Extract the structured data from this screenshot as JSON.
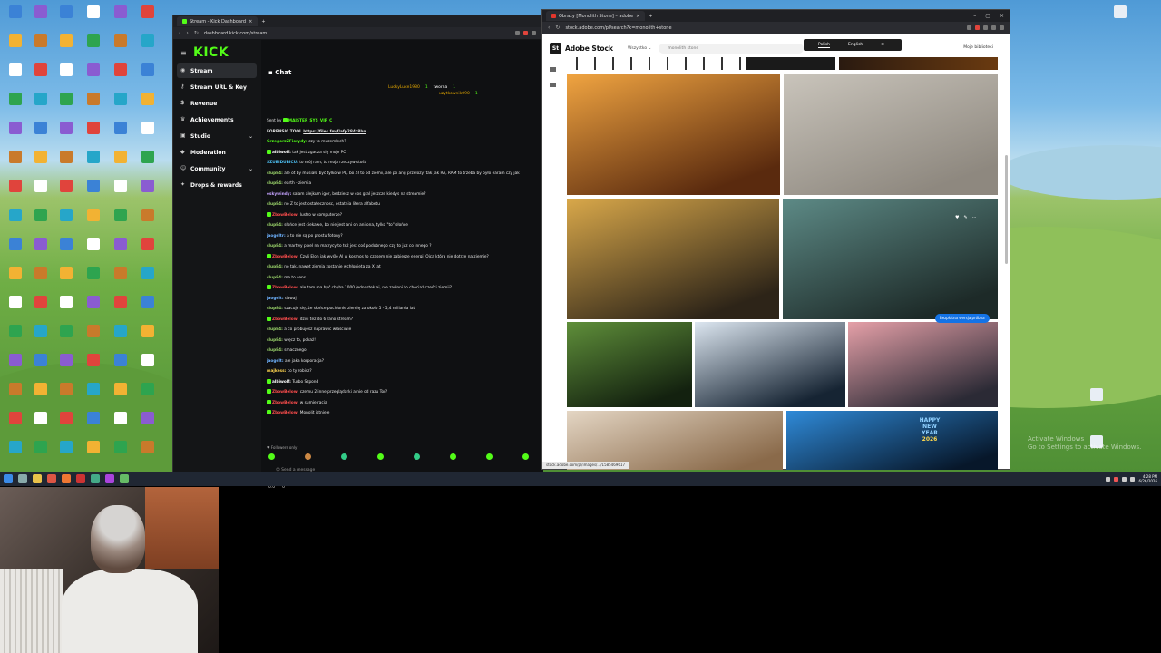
{
  "kick_window": {
    "tab_title": "Stream - Kick Dashboard",
    "url": "dashboard.kick.com/stream",
    "logo": "KICK",
    "nav": [
      "Stream",
      "Stream URL & Key",
      "Revenue",
      "Achievements",
      "Studio",
      "Moderation",
      "Community",
      "Drops & rewards"
    ],
    "chat_title": "Chat",
    "leaderboard": [
      {
        "name": "LuckyLuke1980",
        "count": "1"
      },
      {
        "name": "tworna",
        "count": "1"
      },
      {
        "name": "uzytkownik090",
        "count": "1"
      }
    ],
    "pinned": {
      "sent_by": "Sent by",
      "sender": "MAJSTER_SYS_VIP_C",
      "tool_label": "FORENSIC TOOL",
      "tool_url": "https://files.fm/f/afp284c8hn"
    },
    "messages": [
      {
        "user": "GrzegorzZFiorydy:",
        "text": "czy to muzemlech?"
      },
      {
        "user": "albiwolf:",
        "text": "tak jest zgadza się moje PC"
      },
      {
        "user": "SZUBIDUBICU:",
        "text": "to mój ram, to moja rzeczywistość"
      },
      {
        "user": "slup84:",
        "text": "ale ot by musiało być tylko w PL, bo Zł to od ziemii, ale po ang przelożył tak jak RA, RAM to trzeba by było earam czy jak"
      },
      {
        "user": "slup84:",
        "text": "earth - ziemia"
      },
      {
        "user": "eskywindy:",
        "text": "salam alejkum igor, bedziesz w cos gral jeszcze kiedys na streamie?"
      },
      {
        "user": "slup84:",
        "text": "no Z to jest ostatecznosc, ostatnia litera alfabetu"
      },
      {
        "user": "ZbowBelow:",
        "text": "lustro w komputerze?"
      },
      {
        "user": "slup84:",
        "text": "słońce jest ciekawe, bo nie jest ani on ani ona, tylko \"to\" słońce"
      },
      {
        "user": "jaogeltr:",
        "text": "a to nie są po prostu fotony?"
      },
      {
        "user": "slup84:",
        "text": "a martwy pixel na matrycy to też jest coś podobnego czy to juz co innego ?"
      },
      {
        "user": "ZbowBelow:",
        "text": "Czyli Elon jak wyśle AI w kosmos to czasem nie zabierze energii Ojca która nie dotrze na ziemie?"
      },
      {
        "user": "slup84:",
        "text": "no tak, nawet ziemia zostanie wchłonięta za X lat"
      },
      {
        "user": "slup84:",
        "text": "ma to sens"
      },
      {
        "user": "ZbowBelow:",
        "text": "ale tam ma być chyba 1000 jednostek ai, nie zasłoni to chociaż cześci ziemii?"
      },
      {
        "user": "jaogelt:",
        "text": "dawaj"
      },
      {
        "user": "slup84:",
        "text": "szacuje się, że słońce pochłonie ziemię za około 5 - 5,4 miliarda lat"
      },
      {
        "user": "ZbowBelow:",
        "text": "dzisi tez do 6 rano stream?"
      },
      {
        "user": "slup84:",
        "text": "a co probujesz naprawic własciwie"
      },
      {
        "user": "slup84:",
        "text": "więcz to, pokaż!"
      },
      {
        "user": "slup84:",
        "text": "smacznego"
      },
      {
        "user": "jaogelt:",
        "text": "ale jaka korporacja?"
      },
      {
        "user": "majkess:",
        "text": "co ty robisz?"
      },
      {
        "user": "albiwolf:",
        "text": "Turbo Szpond"
      },
      {
        "user": "ZbowBelow:",
        "text": "czemu 2 inne przeglądarki a nie od razu Tor?"
      },
      {
        "user": "ZbowBelow:",
        "text": "w sumie racja"
      },
      {
        "user": "ZbowBelow:",
        "text": "Monolit istnieje"
      }
    ],
    "followers_only": "Followers only",
    "input_placeholder": "Send a message",
    "meta_left": "0.0",
    "meta_right": "0"
  },
  "adobe_window": {
    "tab_title": "Obrazy [Monolith Stone] – adobe",
    "url": "stock.adobe.com/pl/search?k=monolith+stone",
    "brand": "Adobe Stock",
    "filter": "Wszystko",
    "search_value": "monolith stone",
    "lang_options": [
      "Polish",
      "English"
    ],
    "library": "Moje biblioteki",
    "pro_badge": "Bezpłatna wersja próbna",
    "status_url": "stock.adobe.com/pl/images/.../1585469617",
    "thumbnails": [
      {
        "subject": "desert rock canyon",
        "c1": "#f0a441",
        "c2": "#5a2a0e"
      },
      {
        "subject": "stone texture",
        "c1": "#c9c4bb",
        "c2": "#8e887f"
      },
      {
        "subject": "glowing colosseum ruins",
        "c1": "#d9a84a",
        "c2": "#2d2418"
      },
      {
        "subject": "monolith in misty forest",
        "c1": "#5d8a86",
        "c2": "#1d2a28"
      },
      {
        "subject": "stone in green jungle",
        "c1": "#5f8f3a",
        "c2": "#13210f"
      },
      {
        "subject": "monolith under full moon",
        "c1": "#dce6f0",
        "c2": "#162433"
      },
      {
        "subject": "sunset standing stones",
        "c1": "#e5a0a8",
        "c2": "#2b2a35"
      },
      {
        "subject": "rock formations",
        "c1": "#e4d6c4",
        "c2": "#8a6a4a"
      },
      {
        "subject": "happy new year 2026",
        "c1": "#2f8ad8",
        "c2": "#07172a"
      }
    ],
    "new_year_text": [
      "HAPPY",
      "NEW",
      "YEAR",
      "2026"
    ]
  },
  "desktop": {
    "watermark": [
      "Activate Windows",
      "Go to Settings to activate Windows."
    ],
    "clock_time": "4:28 PM",
    "clock_date": "6/26/2026"
  }
}
